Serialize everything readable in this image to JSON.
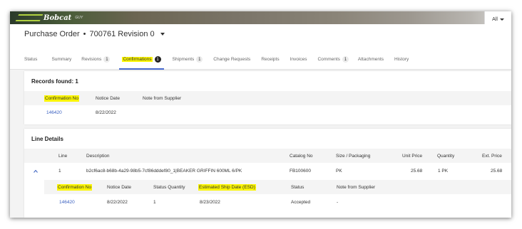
{
  "app": {
    "logo_text": "Bobcat",
    "logo_sub": "GUY",
    "all_label": "All"
  },
  "header": {
    "title": "Purchase Order",
    "separator": "•",
    "po_number": "700761 Revision 0"
  },
  "tabs": [
    {
      "label": "Status",
      "badge": null
    },
    {
      "label": "Summary",
      "badge": null
    },
    {
      "label": "Revisions",
      "badge": "1"
    },
    {
      "label": "Confirmations",
      "badge": "1",
      "active": true
    },
    {
      "label": "Shipments",
      "badge": "1"
    },
    {
      "label": "Change Requests",
      "badge": null
    },
    {
      "label": "Receipts",
      "badge": null
    },
    {
      "label": "Invoices",
      "badge": null
    },
    {
      "label": "Comments",
      "badge": "1"
    },
    {
      "label": "Attachments",
      "badge": null
    },
    {
      "label": "History",
      "badge": null
    }
  ],
  "records": {
    "title": "Records found: 1",
    "columns": [
      "Confirmation No",
      "Notice Date",
      "Note from Supplier"
    ],
    "rows": [
      {
        "confirmation_no": "146420",
        "notice_date": "8/22/2022",
        "note": ""
      }
    ]
  },
  "line_details": {
    "title": "Line Details",
    "columns": [
      "Line",
      "Description",
      "Catalog No",
      "Size / Packaging",
      "Unit Price",
      "Quantity",
      "Ext. Price"
    ],
    "rows": [
      {
        "line": "1",
        "description": "b2cf6ac8-b68b-4a29-98b5-7cf86dddef80_1|BEAKER GRIFFIN 600ML 6/PK",
        "catalog_no": "FB100600",
        "size": "PK",
        "unit_price": "25.68",
        "quantity": "1 PK",
        "ext_price": "25.68"
      }
    ],
    "sub_columns": [
      "Confirmation No",
      "Notice Date",
      "Status Quantity",
      "Estimated Ship Date (ESD)",
      "Status",
      "Note from Supplier"
    ],
    "sub_rows": [
      {
        "confirmation_no": "146420",
        "notice_date": "8/22/2022",
        "status_quantity": "1",
        "esd": "8/23/2022",
        "status": "Accepted",
        "note": "-"
      }
    ]
  },
  "colors": {
    "highlight": "#fbf500",
    "link": "#3a60c0",
    "active_tab_underline": "#4466cc"
  }
}
